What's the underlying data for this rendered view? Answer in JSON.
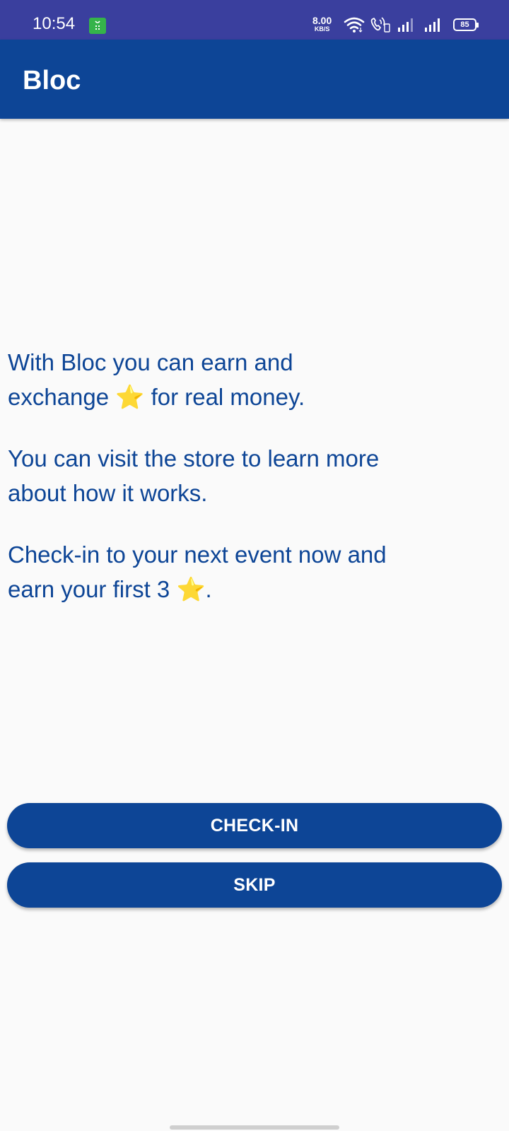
{
  "status_bar": {
    "time": "10:54",
    "net_speed_value": "8.00",
    "net_speed_unit": "KB/S",
    "battery_level": "85",
    "icons": [
      "app-notification-icon",
      "wifi-icon",
      "volte-call-icon",
      "signal-icon",
      "signal-icon",
      "battery-icon"
    ]
  },
  "app_bar": {
    "title": "Bloc"
  },
  "content": {
    "para1_a": "With Bloc you can earn and",
    "para1_b": "exchange",
    "para1_c": "for real money.",
    "para2_a": "You can visit the store to learn more",
    "para2_b": "about how it works.",
    "para3_a": "Check-in to your next event now and",
    "para3_b": "earn your first 3",
    "para3_c": ".",
    "star_glyph": "⭐"
  },
  "buttons": {
    "checkin_label": "CHECK-IN",
    "skip_label": "SKIP"
  },
  "colors": {
    "primary": "#0d4596",
    "status_bar": "#3a3f9e",
    "background": "#fafafa"
  }
}
